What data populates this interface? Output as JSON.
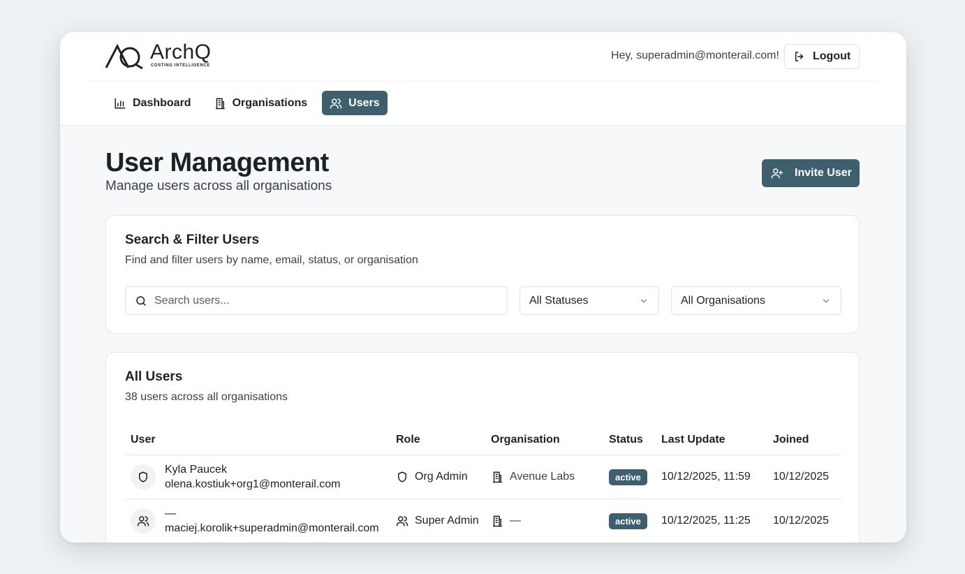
{
  "brand": {
    "logo_text": "ArchQ",
    "tagline": "COSTING INTELLIGENCE"
  },
  "header": {
    "greeting": "Hey, superadmin@monterail.com!",
    "logout_label": "Logout"
  },
  "nav": {
    "items": [
      {
        "label": "Dashboard",
        "icon": "bar-chart-icon",
        "active": false
      },
      {
        "label": "Organisations",
        "icon": "building-icon",
        "active": false
      },
      {
        "label": "Users",
        "icon": "users-icon",
        "active": true
      }
    ]
  },
  "page": {
    "title": "User Management",
    "subtitle": "Manage users across all organisations",
    "invite_label": "Invite User"
  },
  "filter_card": {
    "title": "Search & Filter Users",
    "description": "Find and filter users by name, email, status, or organisation",
    "search_placeholder": "Search users...",
    "search_value": "",
    "status_select": "All Statuses",
    "org_select": "All Organisations"
  },
  "users_card": {
    "title": "All Users",
    "description": "38 users across all organisations",
    "columns": [
      "User",
      "Role",
      "Organisation",
      "Status",
      "Last Update",
      "Joined"
    ],
    "rows": [
      {
        "name": "Kyla Paucek",
        "email": "olena.kostiuk+org1@monterail.com",
        "avatar_icon": "shield-icon",
        "role": "Org Admin",
        "role_icon": "shield-icon",
        "organisation": "Avenue Labs",
        "status": "active",
        "last_update": "10/12/2025, 11:59",
        "joined": "10/12/2025"
      },
      {
        "name": "—",
        "email": "maciej.korolik+superadmin@monterail.com",
        "avatar_icon": "users-icon",
        "role": "Super Admin",
        "role_icon": "users-icon",
        "organisation": "—",
        "status": "active",
        "last_update": "10/12/2025, 11:25",
        "joined": "10/12/2025"
      }
    ]
  },
  "colors": {
    "primary": "#3e5f6d",
    "background": "#f6f8f9",
    "text": "#1c2126"
  }
}
